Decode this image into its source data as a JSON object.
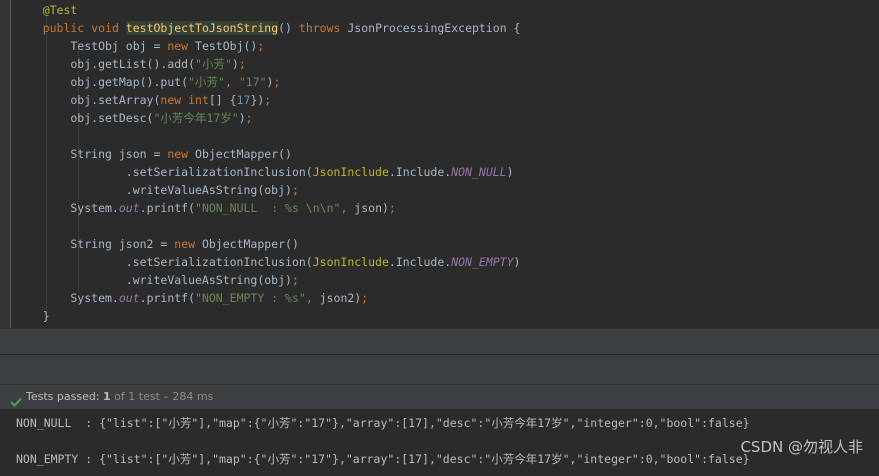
{
  "editor": {
    "lines": [
      [
        {
          "t": "    ",
          "c": "plain"
        },
        {
          "t": "@Test",
          "c": "ann"
        }
      ],
      [
        {
          "t": "    ",
          "c": "plain"
        },
        {
          "t": "public void ",
          "c": "kw"
        },
        {
          "t": "testObjectToJsonString",
          "c": "method-hl"
        },
        {
          "t": "() ",
          "c": "plain"
        },
        {
          "t": "throws ",
          "c": "kw"
        },
        {
          "t": "JsonProcessingException {",
          "c": "plain"
        }
      ],
      [
        {
          "t": "        TestObj obj = ",
          "c": "plain"
        },
        {
          "t": "new ",
          "c": "kw"
        },
        {
          "t": "TestObj()",
          "c": "plain"
        },
        {
          "t": ";",
          "c": "kw"
        }
      ],
      [
        {
          "t": "        obj.getList().add(",
          "c": "plain"
        },
        {
          "t": "\"小芳\"",
          "c": "str"
        },
        {
          "t": ")",
          "c": "plain"
        },
        {
          "t": ";",
          "c": "kw"
        }
      ],
      [
        {
          "t": "        obj.getMap().put(",
          "c": "plain"
        },
        {
          "t": "\"小芳\"",
          "c": "str"
        },
        {
          "t": ", ",
          "c": "kw"
        },
        {
          "t": "\"17\"",
          "c": "str"
        },
        {
          "t": ")",
          "c": "plain"
        },
        {
          "t": ";",
          "c": "kw"
        }
      ],
      [
        {
          "t": "        obj.setArray(",
          "c": "plain"
        },
        {
          "t": "new int",
          "c": "kw"
        },
        {
          "t": "[] {",
          "c": "plain"
        },
        {
          "t": "17",
          "c": "num"
        },
        {
          "t": "})",
          "c": "plain"
        },
        {
          "t": ";",
          "c": "kw"
        }
      ],
      [
        {
          "t": "        obj.setDesc(",
          "c": "plain"
        },
        {
          "t": "\"小芳今年17岁\"",
          "c": "str"
        },
        {
          "t": ")",
          "c": "plain"
        },
        {
          "t": ";",
          "c": "kw"
        }
      ],
      [],
      [
        {
          "t": "        String json = ",
          "c": "plain"
        },
        {
          "t": "new ",
          "c": "kw"
        },
        {
          "t": "ObjectMapper()",
          "c": "plain"
        }
      ],
      [
        {
          "t": "                .setSerializationInclusion(",
          "c": "plain"
        },
        {
          "t": "JsonInclude",
          "c": "cls-hl"
        },
        {
          "t": ".Include.",
          "c": "plain"
        },
        {
          "t": "NON_NULL",
          "c": "static"
        },
        {
          "t": ")",
          "c": "plain"
        }
      ],
      [
        {
          "t": "                .writeValueAsString(obj)",
          "c": "plain"
        },
        {
          "t": ";",
          "c": "kw"
        }
      ],
      [
        {
          "t": "        System.",
          "c": "plain"
        },
        {
          "t": "out",
          "c": "static"
        },
        {
          "t": ".printf(",
          "c": "plain"
        },
        {
          "t": "\"NON_NULL  : %s \\n\\n\"",
          "c": "str"
        },
        {
          "t": ", ",
          "c": "kw"
        },
        {
          "t": "json)",
          "c": "plain"
        },
        {
          "t": ";",
          "c": "kw"
        }
      ],
      [],
      [
        {
          "t": "        String json2 = ",
          "c": "plain"
        },
        {
          "t": "new ",
          "c": "kw"
        },
        {
          "t": "ObjectMapper()",
          "c": "plain"
        }
      ],
      [
        {
          "t": "                .setSerializationInclusion(",
          "c": "plain"
        },
        {
          "t": "JsonInclude",
          "c": "cls-hl"
        },
        {
          "t": ".Include.",
          "c": "plain"
        },
        {
          "t": "NON_EMPTY",
          "c": "static"
        },
        {
          "t": ")",
          "c": "plain"
        }
      ],
      [
        {
          "t": "                .writeValueAsString(obj)",
          "c": "plain"
        },
        {
          "t": ";",
          "c": "kw"
        }
      ],
      [
        {
          "t": "        System.",
          "c": "plain"
        },
        {
          "t": "out",
          "c": "static"
        },
        {
          "t": ".printf(",
          "c": "plain"
        },
        {
          "t": "\"NON_EMPTY : %s\"",
          "c": "str"
        },
        {
          "t": ", ",
          "c": "kw"
        },
        {
          "t": "json2)",
          "c": "plain"
        },
        {
          "t": ";",
          "c": "kw"
        }
      ],
      [
        {
          "t": "    }",
          "c": "plain"
        }
      ]
    ]
  },
  "test_results": {
    "status_icon": "check-icon",
    "prefix": "Tests passed: ",
    "count": "1",
    "rest": " of 1 test – 284 ms"
  },
  "console": {
    "lines": [
      "NON_NULL  : {\"list\":[\"小芳\"],\"map\":{\"小芳\":\"17\"},\"array\":[17],\"desc\":\"小芳今年17岁\",\"integer\":0,\"bool\":false}",
      "NON_EMPTY : {\"list\":[\"小芳\"],\"map\":{\"小芳\":\"17\"},\"array\":[17],\"desc\":\"小芳今年17岁\",\"integer\":0,\"bool\":false}"
    ]
  },
  "watermark": "CSDN @勿视人非",
  "colors": {
    "editor_bg": "#2b2b2b",
    "panel_bg": "#3c3f41",
    "keyword": "#cc7832",
    "string": "#6a8759",
    "number": "#6897bb",
    "annotation": "#bbb529",
    "method_decl": "#ffc66d",
    "static_field": "#9876aa",
    "pass_green": "#499c54"
  }
}
